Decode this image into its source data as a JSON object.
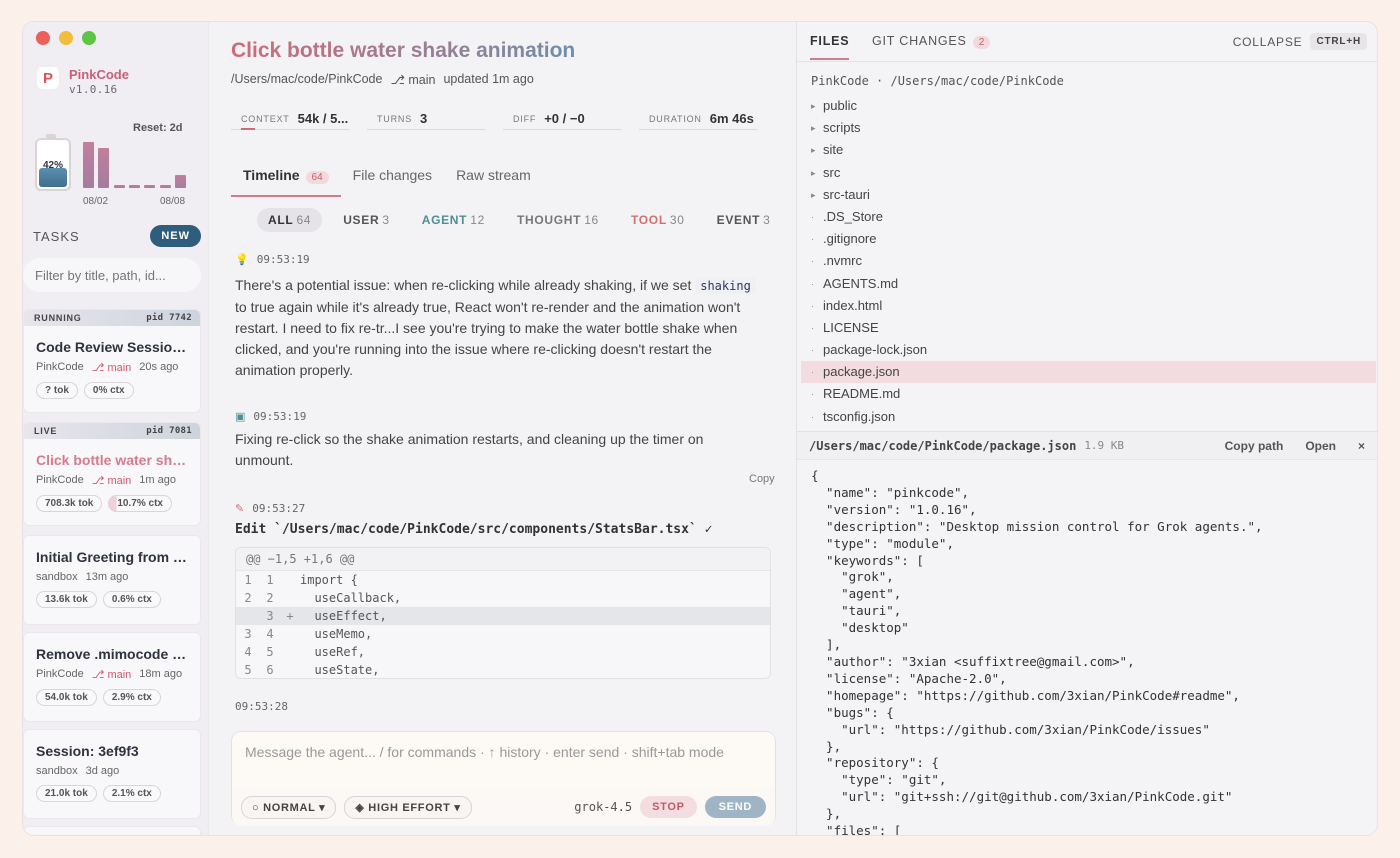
{
  "app": {
    "name": "PinkCode",
    "version": "v1.0.16",
    "logo_letter": "P"
  },
  "usage": {
    "reset_label": "Reset: 2d",
    "battery_pct": 42,
    "battery_label": "42%",
    "bars": [
      0.93,
      0.81,
      0.06,
      0.06,
      0.06,
      0.06,
      0.26
    ],
    "date_start": "08/02",
    "date_end": "08/08"
  },
  "tasks_header": {
    "title": "TASKS",
    "new_label": "NEW",
    "filter_placeholder": "Filter by title, path, id..."
  },
  "tasks": [
    {
      "band": "RUNNING",
      "pid": "pid 7742",
      "title": "Code Review Session ...",
      "project": "PinkCode",
      "branch": "main",
      "ago": "20s ago",
      "tok": "? tok",
      "ctx": "0% ctx",
      "status": "running"
    },
    {
      "band": "LIVE",
      "pid": "pid 7081",
      "title": "Click bottle water sha...",
      "project": "PinkCode",
      "branch": "main",
      "ago": "1m ago",
      "tok": "708.3k tok",
      "ctx": "10.7% ctx",
      "status": "live"
    },
    {
      "title": "Initial Greeting from U...",
      "project": "sandbox",
      "ago": "13m ago",
      "tok": "13.6k tok",
      "ctx": "0.6% ctx"
    },
    {
      "title": "Remove .mimocode a...",
      "project": "PinkCode",
      "branch": "main",
      "ago": "18m ago",
      "tok": "54.0k tok",
      "ctx": "2.9% ctx"
    },
    {
      "title": "Session: 3ef9f3",
      "project": "sandbox",
      "ago": "3d ago",
      "tok": "21.0k tok",
      "ctx": "2.1% ctx"
    }
  ],
  "session": {
    "title": "Click bottle water shake animation",
    "path": "/Users/mac/code/PinkCode",
    "branch": "main",
    "updated": "updated 1m ago",
    "stats": [
      {
        "key": "CONTEXT",
        "value": "54k / 5..."
      },
      {
        "key": "TURNS",
        "value": "3"
      },
      {
        "key": "DIFF",
        "value": "+0 / −0"
      },
      {
        "key": "DURATION",
        "value": "6m 46s"
      }
    ],
    "context_fraction": 0.107
  },
  "view_tabs": [
    {
      "label": "Timeline",
      "badge": "64"
    },
    {
      "label": "File changes"
    },
    {
      "label": "Raw stream"
    }
  ],
  "filters": [
    {
      "label": "ALL",
      "count": "64",
      "color": "#333333"
    },
    {
      "label": "USER",
      "count": "3",
      "color": "#555555"
    },
    {
      "label": "AGENT",
      "count": "12",
      "color": "#4f8e95"
    },
    {
      "label": "THOUGHT",
      "count": "16",
      "color": "#777777"
    },
    {
      "label": "TOOL",
      "count": "30",
      "color": "#d07070"
    },
    {
      "label": "EVENT",
      "count": "3",
      "color": "#555555"
    }
  ],
  "timeline": {
    "t1": "09:53:19",
    "m1_a": "There's a potential issue: when re-clicking while already shaking, if we set ",
    "m1_code": "shaking",
    "m1_b": " to true again while it's already true, React won't re-render and the animation won't restart. I need to fix re-tr...I see you're trying to make the water bottle shake when clicked, and you're running into the issue where re-clicking doesn't restart the animation properly.",
    "t2": "09:53:19",
    "m2": "Fixing re-click so the shake animation restarts, and cleaning up the timer on unmount.",
    "copy": "Copy",
    "t3": "09:53:27",
    "edit": "Edit `/Users/mac/code/PinkCode/src/components/StatsBar.tsx` ✓",
    "diff_header": "@@ −1,5 +1,6 @@",
    "diff": [
      {
        "a": "1",
        "b": "1",
        "sign": "",
        "code": "import {"
      },
      {
        "a": "2",
        "b": "2",
        "sign": "",
        "code": "  useCallback,"
      },
      {
        "a": "",
        "b": "3",
        "sign": "+",
        "code": "  useEffect,"
      },
      {
        "a": "3",
        "b": "4",
        "sign": "",
        "code": "  useMemo,"
      },
      {
        "a": "4",
        "b": "5",
        "sign": "",
        "code": "  useRef,"
      },
      {
        "a": "5",
        "b": "6",
        "sign": "",
        "code": "  useState,"
      }
    ],
    "t4": "09:53:28"
  },
  "composer": {
    "placeholder": "Message the agent... / for commands · ↑ history · enter send · shift+tab mode",
    "mode": "NORMAL",
    "effort": "HIGH EFFORT",
    "model": "grok-4.5",
    "stop": "STOP",
    "send": "SEND"
  },
  "right": {
    "tab_files": "FILES",
    "tab_git": "GIT CHANGES",
    "git_badge": "2",
    "collapse": "COLLAPSE",
    "shortcut": "CTRL+H",
    "root": "PinkCode · /Users/mac/code/PinkCode",
    "tree": [
      "public",
      "scripts",
      "site",
      "src",
      "src-tauri",
      ".DS_Store",
      ".gitignore",
      ".nvmrc",
      "AGENTS.md",
      "index.html",
      "LICENSE",
      "package-lock.json",
      "package.json",
      "README.md",
      "tsconfig.json"
    ],
    "tree_dirs": [
      0,
      1,
      2,
      3,
      4
    ],
    "selected": "package.json",
    "file_path": "/Users/mac/code/PinkCode/package.json",
    "file_size": "1.9 KB",
    "copy_path": "Copy path",
    "open": "Open",
    "close": "×",
    "json_lines": [
      "{",
      "  \"name\": \"pinkcode\",",
      "  \"version\": \"1.0.16\",",
      "  \"description\": \"Desktop mission control for Grok agents.\",",
      "  \"type\": \"module\",",
      "  \"keywords\": [",
      "    \"grok\",",
      "    \"agent\",",
      "    \"tauri\",",
      "    \"desktop\"",
      "  ],",
      "  \"author\": \"3xian <suffixtree@gmail.com>\",",
      "  \"license\": \"Apache-2.0\",",
      "  \"homepage\": \"https://github.com/3xian/PinkCode#readme\",",
      "  \"bugs\": {",
      "    \"url\": \"https://github.com/3xian/PinkCode/issues\"",
      "  },",
      "  \"repository\": {",
      "    \"type\": \"git\",",
      "    \"url\": \"git+ssh://git@github.com/3xian/PinkCode.git\"",
      "  },",
      "  \"files\": ["
    ]
  }
}
